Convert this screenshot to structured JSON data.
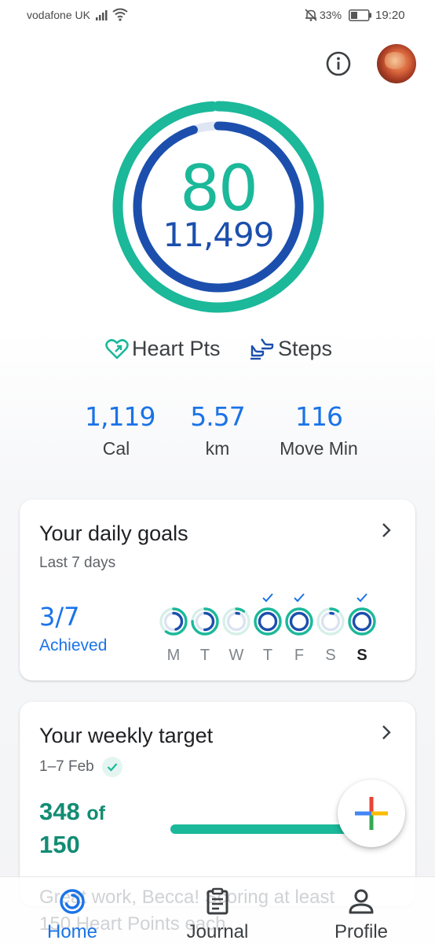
{
  "status_bar": {
    "carrier": "vodafone UK",
    "battery": "33%",
    "time": "19:20"
  },
  "header": {
    "info_icon": "info-icon",
    "avatar": "profile-avatar"
  },
  "summary": {
    "heart_points": "80",
    "steps": "11,499",
    "heart_points_ring_fraction": 0.99,
    "steps_ring_fraction": 0.95,
    "legend": [
      {
        "label": "Heart Pts",
        "icon": "heart-points-icon",
        "color": "#1bb89a"
      },
      {
        "label": "Steps",
        "icon": "steps-icon",
        "color": "#1c4fad"
      }
    ],
    "stats": [
      {
        "value": "1,119",
        "label": "Cal"
      },
      {
        "value": "5.57",
        "label": "km"
      },
      {
        "value": "116",
        "label": "Move Min"
      }
    ]
  },
  "daily_goals": {
    "title": "Your daily goals",
    "subtitle": "Last 7 days",
    "achieved_count": "3/7",
    "achieved_label": "Achieved",
    "days": [
      {
        "letter": "M",
        "achieved": false,
        "steps_fraction": 0.45,
        "heart_fraction": 0.6,
        "today": false
      },
      {
        "letter": "T",
        "achieved": false,
        "steps_fraction": 0.5,
        "heart_fraction": 0.75,
        "today": false
      },
      {
        "letter": "W",
        "achieved": false,
        "steps_fraction": 0.05,
        "heart_fraction": 0.1,
        "today": false
      },
      {
        "letter": "T",
        "achieved": true,
        "steps_fraction": 1.0,
        "heart_fraction": 1.0,
        "today": false
      },
      {
        "letter": "F",
        "achieved": true,
        "steps_fraction": 1.0,
        "heart_fraction": 1.0,
        "today": false
      },
      {
        "letter": "S",
        "achieved": false,
        "steps_fraction": 0.05,
        "heart_fraction": 0.1,
        "today": false
      },
      {
        "letter": "S",
        "achieved": true,
        "steps_fraction": 1.0,
        "heart_fraction": 1.0,
        "today": true
      }
    ]
  },
  "weekly_target": {
    "title": "Your weekly target",
    "date_range": "1–7 Feb",
    "progress_value": "348",
    "progress_of": "of",
    "target_value": "150",
    "progress_fraction": 1.0
  },
  "coach_message": "Great work, Becca! Scoring at least 150 Heart Points each",
  "bottom_nav": [
    {
      "label": "Home",
      "icon": "home-icon",
      "active": true
    },
    {
      "label": "Journal",
      "icon": "journal-icon",
      "active": false
    },
    {
      "label": "Profile",
      "icon": "profile-icon",
      "active": false
    }
  ],
  "colors": {
    "heart_green": "#1bb89a",
    "steps_blue": "#1c4fad",
    "accent_blue": "#1a73e8"
  }
}
